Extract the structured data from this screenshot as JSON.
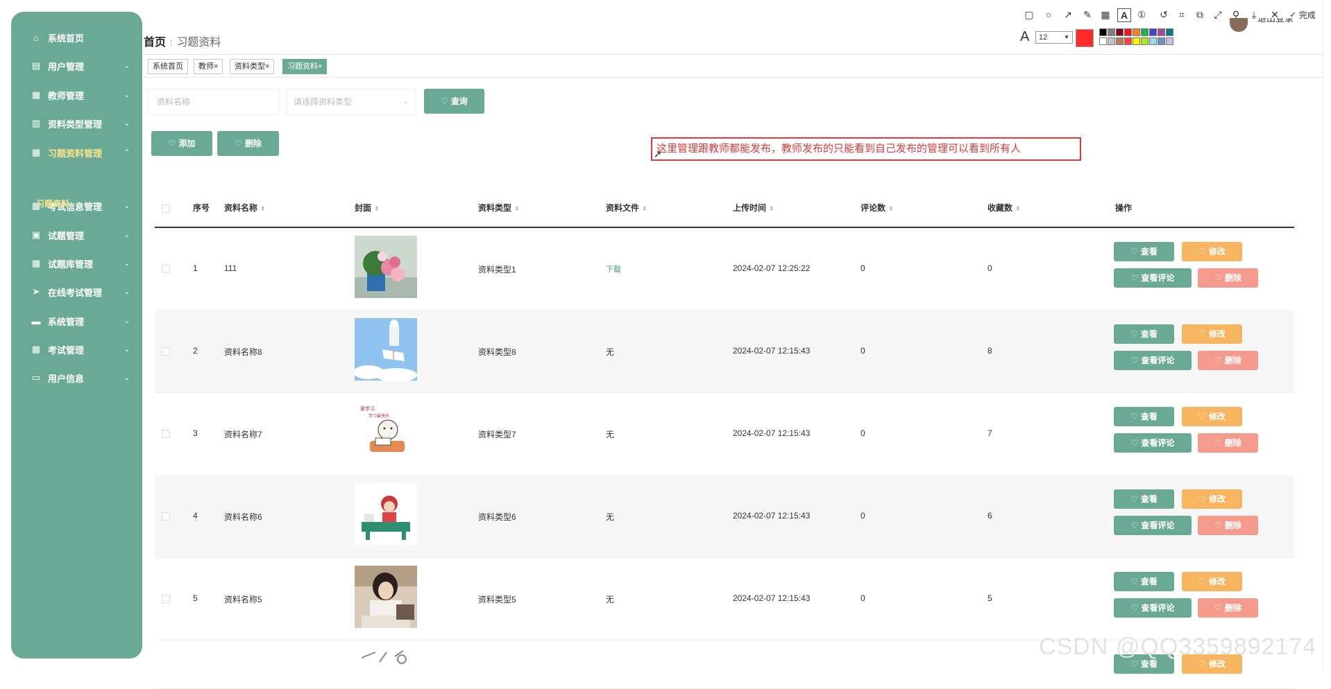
{
  "sidebar": {
    "items": [
      {
        "label": "系统首页",
        "icon": "home-icon",
        "has_chevron": false
      },
      {
        "label": "用户管理",
        "icon": "users-icon",
        "has_chevron": true
      },
      {
        "label": "教师管理",
        "icon": "grid-icon",
        "has_chevron": true
      },
      {
        "label": "资料类型管理",
        "icon": "bar-chart-icon",
        "has_chevron": true
      },
      {
        "label": "习题资料管理",
        "icon": "grid-icon",
        "has_chevron": true,
        "active": true
      },
      {
        "label": "考试信息管理",
        "icon": "grid-icon",
        "has_chevron": true
      },
      {
        "label": "试题管理",
        "icon": "document-icon",
        "has_chevron": true
      },
      {
        "label": "试题库管理",
        "icon": "grid-icon",
        "has_chevron": true
      },
      {
        "label": "在线考试管理",
        "icon": "send-icon",
        "has_chevron": true
      },
      {
        "label": "系统管理",
        "icon": "monitor-icon",
        "has_chevron": true
      },
      {
        "label": "考试管理",
        "icon": "grid-icon",
        "has_chevron": true
      },
      {
        "label": "用户信息",
        "icon": "card-icon",
        "has_chevron": true
      }
    ],
    "sub_item": "习题资料",
    "chevron_char": "⌄",
    "chevron_up_char": "⌃"
  },
  "breadcrumb": {
    "home": "首页",
    "current": "习题资料"
  },
  "tags": [
    {
      "label": "系统首页",
      "closable": false
    },
    {
      "label": "教师",
      "closable": true
    },
    {
      "label": "资料类型",
      "closable": true
    },
    {
      "label": "习题资料",
      "closable": true,
      "active": true
    }
  ],
  "close_char": "×",
  "header": {
    "logout": "退出登录"
  },
  "shot_toolbar": {
    "font_size": "12",
    "done_label": "完成",
    "font_glyph": "A",
    "current_color": "#ff2a2a",
    "palette": [
      "#000000",
      "#7f7f7f",
      "#880015",
      "#ed1c24",
      "#ff7f27",
      "#22b14c",
      "#3f48cc",
      "#a349a4",
      "#008080",
      "#ffffff",
      "#c3c3c3",
      "#b97a57",
      "#ff4040",
      "#fff200",
      "#b5e61d",
      "#99d9ea",
      "#7092be",
      "#c8bfe7"
    ]
  },
  "search": {
    "name_placeholder": "资料名称",
    "type_placeholder": "请选择资料类型",
    "query_label": "查询"
  },
  "actions": {
    "add_label": "添加",
    "delete_label": "删除"
  },
  "annotation": {
    "text": "这里管理跟教师都能发布，教师发布的只能看到自己发布的管理可以看到所有人"
  },
  "table": {
    "columns": [
      "序号",
      "资料名称",
      "封面",
      "资料类型",
      "资料文件",
      "上传时间",
      "评论数",
      "收藏数",
      "操作"
    ],
    "sortable": [
      false,
      true,
      true,
      true,
      true,
      true,
      true,
      true,
      false
    ],
    "row_actions": {
      "view": "查看",
      "edit": "修改",
      "comments": "查看评论",
      "delete": "删除"
    },
    "rows": [
      {
        "index": "1",
        "name": "111",
        "cover": "flowers",
        "type": "资料类型1",
        "file": "下载",
        "time": "2024-02-07 12:25:22",
        "comments": "0",
        "favorites": "0"
      },
      {
        "index": "2",
        "name": "资料名称8",
        "cover": "sky-book",
        "type": "资料类型8",
        "file": "无",
        "time": "2024-02-07 12:15:43",
        "comments": "0",
        "favorites": "8"
      },
      {
        "index": "3",
        "name": "资料名称7",
        "cover": "cartoon-study",
        "type": "资料类型7",
        "file": "无",
        "time": "2024-02-07 12:15:43",
        "comments": "0",
        "favorites": "7"
      },
      {
        "index": "4",
        "name": "资料名称6",
        "cover": "cartoon-desk",
        "type": "资料类型6",
        "file": "无",
        "time": "2024-02-07 12:15:43",
        "comments": "0",
        "favorites": "6"
      },
      {
        "index": "5",
        "name": "资料名称5",
        "cover": "student-photo",
        "type": "资料类型5",
        "file": "无",
        "time": "2024-02-07 12:15:43",
        "comments": "0",
        "favorites": "5"
      }
    ],
    "partial_row_actions": {
      "view": "查看",
      "edit": "修改"
    }
  },
  "watermark": "CSDN @QQ3359892174",
  "colors": {
    "primary": "#6aa996",
    "edit": "#f7b55f",
    "delete": "#f59b8e",
    "annotation": "#d63a3a",
    "active_nav": "#f7e48e"
  }
}
